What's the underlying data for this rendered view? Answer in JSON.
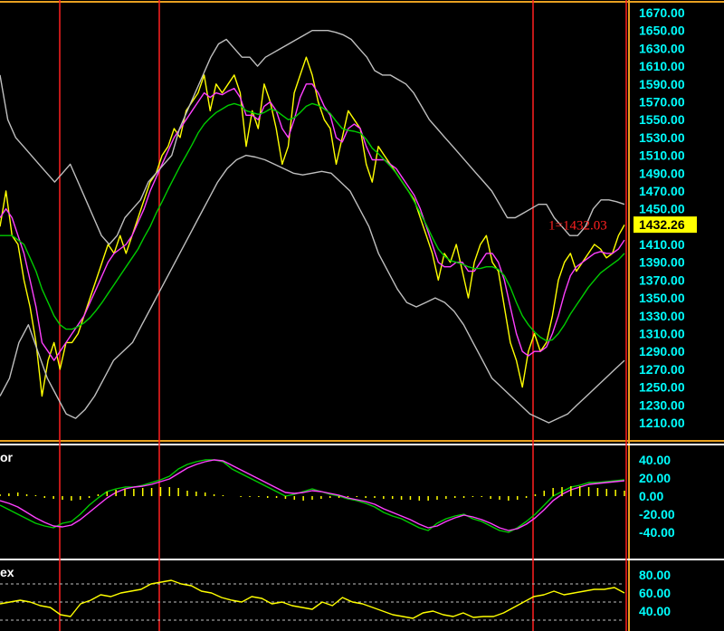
{
  "chart_data": [
    {
      "type": "line",
      "panel": "price",
      "ylim": [
        1200,
        1680
      ],
      "ticks": [
        "1670.00",
        "1650.00",
        "1630.00",
        "1610.00",
        "1590.00",
        "1570.00",
        "1550.00",
        "1530.00",
        "1510.00",
        "1490.00",
        "1470.00",
        "1450.00",
        "1430.00",
        "1410.00",
        "1390.00",
        "1370.00",
        "1350.00",
        "1330.00",
        "1310.00",
        "1290.00",
        "1270.00",
        "1250.00",
        "1230.00",
        "1210.00"
      ],
      "tick_values": [
        1670,
        1650,
        1630,
        1610,
        1590,
        1570,
        1550,
        1530,
        1510,
        1490,
        1470,
        1450,
        1430,
        1410,
        1390,
        1370,
        1350,
        1330,
        1310,
        1290,
        1270,
        1250,
        1230,
        1210
      ],
      "annotation": "1=1432.03",
      "annotation_value": 1432.03,
      "last_price_label": "1432.26",
      "last_price_value": 1432.26,
      "series": [
        {
          "color": "#ffff00",
          "values": [
            1430,
            1470,
            1420,
            1410,
            1370,
            1340,
            1300,
            1240,
            1280,
            1300,
            1270,
            1300,
            1300,
            1310,
            1330,
            1350,
            1370,
            1390,
            1410,
            1400,
            1420,
            1400,
            1420,
            1440,
            1460,
            1480,
            1490,
            1510,
            1520,
            1540,
            1530,
            1560,
            1570,
            1580,
            1600,
            1560,
            1590,
            1580,
            1590,
            1600,
            1580,
            1520,
            1560,
            1540,
            1590,
            1570,
            1540,
            1500,
            1520,
            1580,
            1600,
            1620,
            1600,
            1570,
            1550,
            1540,
            1500,
            1530,
            1560,
            1550,
            1540,
            1500,
            1480,
            1520,
            1510,
            1500,
            1490,
            1480,
            1470,
            1460,
            1440,
            1420,
            1400,
            1370,
            1400,
            1390,
            1410,
            1380,
            1350,
            1390,
            1410,
            1420,
            1390,
            1380,
            1340,
            1300,
            1280,
            1250,
            1290,
            1310,
            1290,
            1300,
            1330,
            1370,
            1390,
            1400,
            1380,
            1390,
            1400,
            1410,
            1405,
            1395,
            1400,
            1420,
            1432
          ]
        },
        {
          "color": "#ff40ff",
          "values": [
            1440,
            1450,
            1440,
            1420,
            1400,
            1370,
            1340,
            1300,
            1290,
            1280,
            1290,
            1300,
            1310,
            1320,
            1330,
            1345,
            1360,
            1375,
            1390,
            1400,
            1405,
            1410,
            1420,
            1435,
            1450,
            1470,
            1485,
            1500,
            1515,
            1530,
            1540,
            1550,
            1560,
            1570,
            1580,
            1575,
            1580,
            1578,
            1582,
            1585,
            1575,
            1555,
            1555,
            1550,
            1565,
            1570,
            1560,
            1540,
            1530,
            1550,
            1575,
            1590,
            1590,
            1580,
            1565,
            1555,
            1530,
            1525,
            1540,
            1545,
            1540,
            1520,
            1505,
            1505,
            1505,
            1500,
            1495,
            1485,
            1475,
            1465,
            1450,
            1430,
            1410,
            1390,
            1385,
            1385,
            1390,
            1390,
            1380,
            1380,
            1390,
            1400,
            1400,
            1390,
            1370,
            1340,
            1310,
            1290,
            1285,
            1290,
            1290,
            1295,
            1310,
            1330,
            1355,
            1375,
            1385,
            1390,
            1395,
            1400,
            1402,
            1400,
            1400,
            1405,
            1415
          ]
        },
        {
          "color": "#00cc00",
          "values": [
            1420,
            1420,
            1420,
            1415,
            1410,
            1395,
            1380,
            1360,
            1345,
            1330,
            1320,
            1315,
            1315,
            1318,
            1322,
            1328,
            1336,
            1345,
            1355,
            1365,
            1375,
            1385,
            1395,
            1405,
            1418,
            1430,
            1445,
            1458,
            1472,
            1485,
            1498,
            1510,
            1522,
            1535,
            1545,
            1552,
            1558,
            1562,
            1566,
            1568,
            1566,
            1560,
            1558,
            1556,
            1558,
            1562,
            1560,
            1555,
            1550,
            1552,
            1558,
            1565,
            1568,
            1566,
            1562,
            1557,
            1548,
            1540,
            1538,
            1537,
            1535,
            1528,
            1518,
            1512,
            1505,
            1498,
            1490,
            1480,
            1470,
            1458,
            1445,
            1432,
            1418,
            1405,
            1397,
            1392,
            1390,
            1388,
            1385,
            1383,
            1383,
            1385,
            1385,
            1382,
            1375,
            1362,
            1345,
            1330,
            1320,
            1312,
            1306,
            1302,
            1303,
            1310,
            1320,
            1332,
            1342,
            1352,
            1362,
            1370,
            1378,
            1383,
            1388,
            1393,
            1400
          ]
        },
        {
          "color": "#bfbfbf",
          "values": [
            1600,
            1550,
            1530,
            1520,
            1510,
            1500,
            1490,
            1480,
            1490,
            1500,
            1480,
            1460,
            1440,
            1420,
            1410,
            1420,
            1440,
            1450,
            1460,
            1480,
            1490,
            1500,
            1510,
            1540,
            1560,
            1580,
            1600,
            1620,
            1635,
            1640,
            1630,
            1620,
            1620,
            1610,
            1620,
            1625,
            1630,
            1635,
            1640,
            1645,
            1650,
            1650,
            1650,
            1648,
            1645,
            1640,
            1630,
            1620,
            1605,
            1600,
            1600,
            1595,
            1590,
            1580,
            1565,
            1550,
            1540,
            1530,
            1520,
            1510,
            1500,
            1490,
            1480,
            1470,
            1455,
            1440,
            1440,
            1445,
            1450,
            1455,
            1455,
            1440,
            1430,
            1420,
            1420,
            1430,
            1450,
            1460,
            1460,
            1458,
            1455
          ]
        },
        {
          "color": "#bfbfbf",
          "values": [
            1240,
            1260,
            1300,
            1320,
            1290,
            1260,
            1240,
            1220,
            1215,
            1225,
            1240,
            1260,
            1280,
            1290,
            1300,
            1320,
            1340,
            1360,
            1380,
            1400,
            1420,
            1440,
            1460,
            1480,
            1495,
            1505,
            1510,
            1508,
            1505,
            1500,
            1495,
            1490,
            1488,
            1490,
            1492,
            1490,
            1480,
            1470,
            1450,
            1430,
            1400,
            1380,
            1360,
            1345,
            1340,
            1345,
            1350,
            1345,
            1335,
            1320,
            1300,
            1280,
            1260,
            1250,
            1240,
            1230,
            1220,
            1215,
            1210,
            1215,
            1220,
            1230,
            1240,
            1250,
            1260,
            1270,
            1280
          ]
        }
      ]
    },
    {
      "type": "line",
      "panel": "oscillator",
      "title": "or",
      "ylim": [
        -50,
        50
      ],
      "ticks": [
        "40.00",
        "20.00",
        "0.00",
        "-20.00",
        "-40.00"
      ],
      "tick_values": [
        40,
        20,
        0,
        -20,
        -40
      ],
      "series": [
        {
          "color": "#00cc00",
          "values": [
            -10,
            -15,
            -20,
            -25,
            -30,
            -33,
            -35,
            -30,
            -28,
            -20,
            -10,
            -2,
            5,
            8,
            10,
            10,
            12,
            15,
            18,
            22,
            30,
            35,
            38,
            40,
            40,
            38,
            30,
            25,
            20,
            15,
            10,
            5,
            0,
            2,
            5,
            8,
            5,
            2,
            0,
            -3,
            -5,
            -8,
            -12,
            -18,
            -22,
            -25,
            -30,
            -35,
            -38,
            -30,
            -25,
            -22,
            -20,
            -25,
            -28,
            -33,
            -38,
            -40,
            -35,
            -28,
            -20,
            -10,
            0,
            5,
            10,
            12,
            15,
            15,
            16,
            17,
            18
          ]
        },
        {
          "color": "#ff40ff",
          "values": [
            -5,
            -8,
            -12,
            -18,
            -24,
            -29,
            -33,
            -34,
            -32,
            -26,
            -18,
            -10,
            -2,
            4,
            8,
            10,
            11,
            13,
            16,
            19,
            25,
            31,
            35,
            38,
            40,
            39,
            34,
            29,
            24,
            19,
            14,
            9,
            4,
            3,
            4,
            6,
            5,
            3,
            1,
            -2,
            -4,
            -6,
            -9,
            -14,
            -18,
            -22,
            -26,
            -31,
            -35,
            -33,
            -28,
            -24,
            -21,
            -23,
            -26,
            -30,
            -35,
            -38,
            -36,
            -31,
            -24,
            -15,
            -5,
            2,
            7,
            10,
            13,
            14,
            15,
            16,
            17
          ]
        },
        {
          "color": "#ffff00",
          "type": "histogram",
          "values": [
            2,
            3,
            4,
            2,
            1,
            -2,
            -3,
            -4,
            -5,
            -4,
            -2,
            2,
            5,
            7,
            8,
            8,
            9,
            9,
            10,
            10,
            9,
            6,
            5,
            4,
            2,
            1,
            0,
            -1,
            -1,
            -1,
            -2,
            -2,
            -3,
            -4,
            -5,
            -4,
            -3,
            -2,
            -2,
            -1,
            -1,
            -2,
            -2,
            -3,
            -3,
            -4,
            -4,
            -5,
            -5,
            -4,
            -3,
            -2,
            -2,
            -1,
            -1,
            -3,
            -4,
            -5,
            -4,
            -2,
            2,
            6,
            9,
            10,
            11,
            11,
            10,
            9,
            8,
            7,
            6
          ]
        }
      ]
    },
    {
      "type": "line",
      "panel": "index",
      "title": "ex",
      "ylim": [
        30,
        85
      ],
      "ticks": [
        "80.00",
        "60.00",
        "40.00"
      ],
      "tick_values": [
        80,
        60,
        40
      ],
      "reference_lines": [
        70,
        50,
        30
      ],
      "series": [
        {
          "color": "#ffff00",
          "values": [
            48,
            50,
            52,
            50,
            46,
            44,
            36,
            34,
            48,
            52,
            58,
            56,
            60,
            62,
            64,
            70,
            72,
            74,
            70,
            68,
            62,
            60,
            55,
            52,
            50,
            56,
            54,
            48,
            50,
            46,
            44,
            42,
            50,
            46,
            55,
            50,
            48,
            44,
            40,
            36,
            34,
            32,
            38,
            40,
            36,
            34,
            38,
            33,
            34,
            34,
            38,
            44,
            50,
            56,
            58,
            62,
            58,
            60,
            62,
            64,
            64,
            66,
            60
          ]
        }
      ]
    }
  ]
}
